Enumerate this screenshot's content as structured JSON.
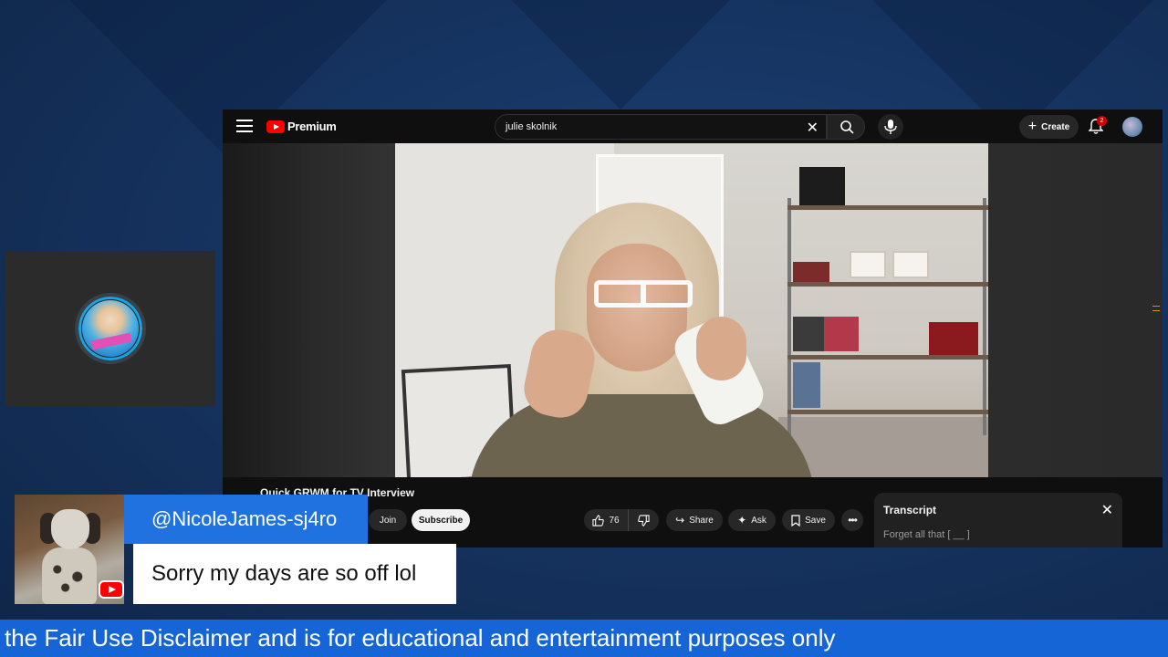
{
  "youtube": {
    "logo_text": "Premium",
    "search": {
      "value": "julie skolnik"
    },
    "create_label": "Create",
    "notifications_count": "2",
    "video_title": "Quick GRWM for TV Interview",
    "join_label": "Join",
    "subscribe_label": "Subscribe",
    "like_count": "76",
    "share_label": "Share",
    "ask_label": "Ask",
    "save_label": "Save",
    "transcript": {
      "title": "Transcript",
      "first_line": "Forget all that [ __ ]"
    }
  },
  "chat": {
    "username": "@NicoleJames-sj4ro",
    "message": "Sorry my days are so off lol"
  },
  "ticker": {
    "text": "the Fair Use Disclaimer and is for educational and entertainment purposes only"
  },
  "colors": {
    "background": "#163461",
    "chat_name_bar": "#1f72e0",
    "ticker": "#1565d6",
    "youtube_red": "#ff0000"
  }
}
